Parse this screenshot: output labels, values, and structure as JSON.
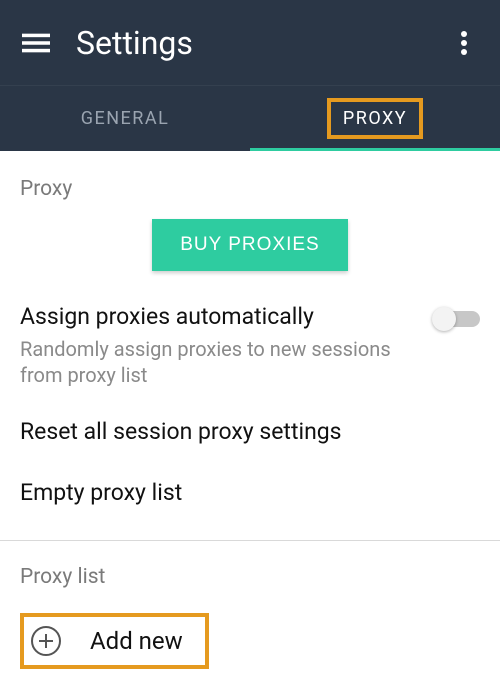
{
  "header": {
    "title": "Settings"
  },
  "tabs": {
    "general": "GENERAL",
    "proxy": "PROXY"
  },
  "proxy": {
    "section_label": "Proxy",
    "buy_label": "BUY PROXIES",
    "assign": {
      "title": "Assign proxies automatically",
      "sub": "Randomly assign proxies to new sessions from proxy list"
    },
    "reset_label": "Reset all session proxy settings",
    "empty_label": "Empty proxy list",
    "list_label": "Proxy list",
    "add_label": "Add new"
  },
  "colors": {
    "accent": "#2ecca0",
    "highlight": "#e59a1f",
    "app_bar": "#2a3646"
  }
}
